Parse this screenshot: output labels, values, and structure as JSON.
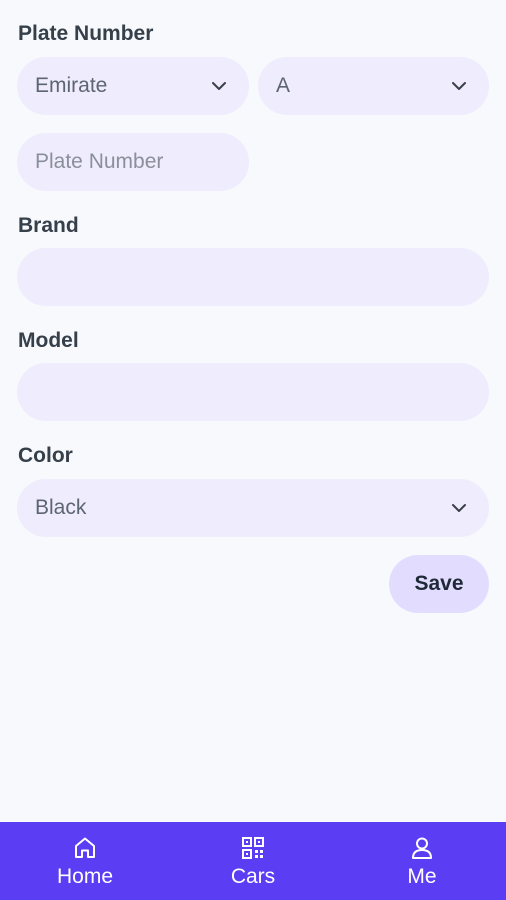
{
  "plate": {
    "label": "Plate Number",
    "emirate_value": "Emirate",
    "code_value": "A",
    "number_placeholder": "Plate Number"
  },
  "brand": {
    "label": "Brand",
    "value": ""
  },
  "model": {
    "label": "Model",
    "value": ""
  },
  "color": {
    "label": "Color",
    "value": "Black"
  },
  "save_label": "Save",
  "nav": [
    {
      "label": "Home",
      "icon": "home-icon"
    },
    {
      "label": "Cars",
      "icon": "qr-code-icon"
    },
    {
      "label": "Me",
      "icon": "user-icon"
    }
  ],
  "colors": {
    "background": "#f8f9fc",
    "field": "#eeecfd",
    "save_button": "#e2ddff",
    "navbar": "#5b3ef4"
  }
}
